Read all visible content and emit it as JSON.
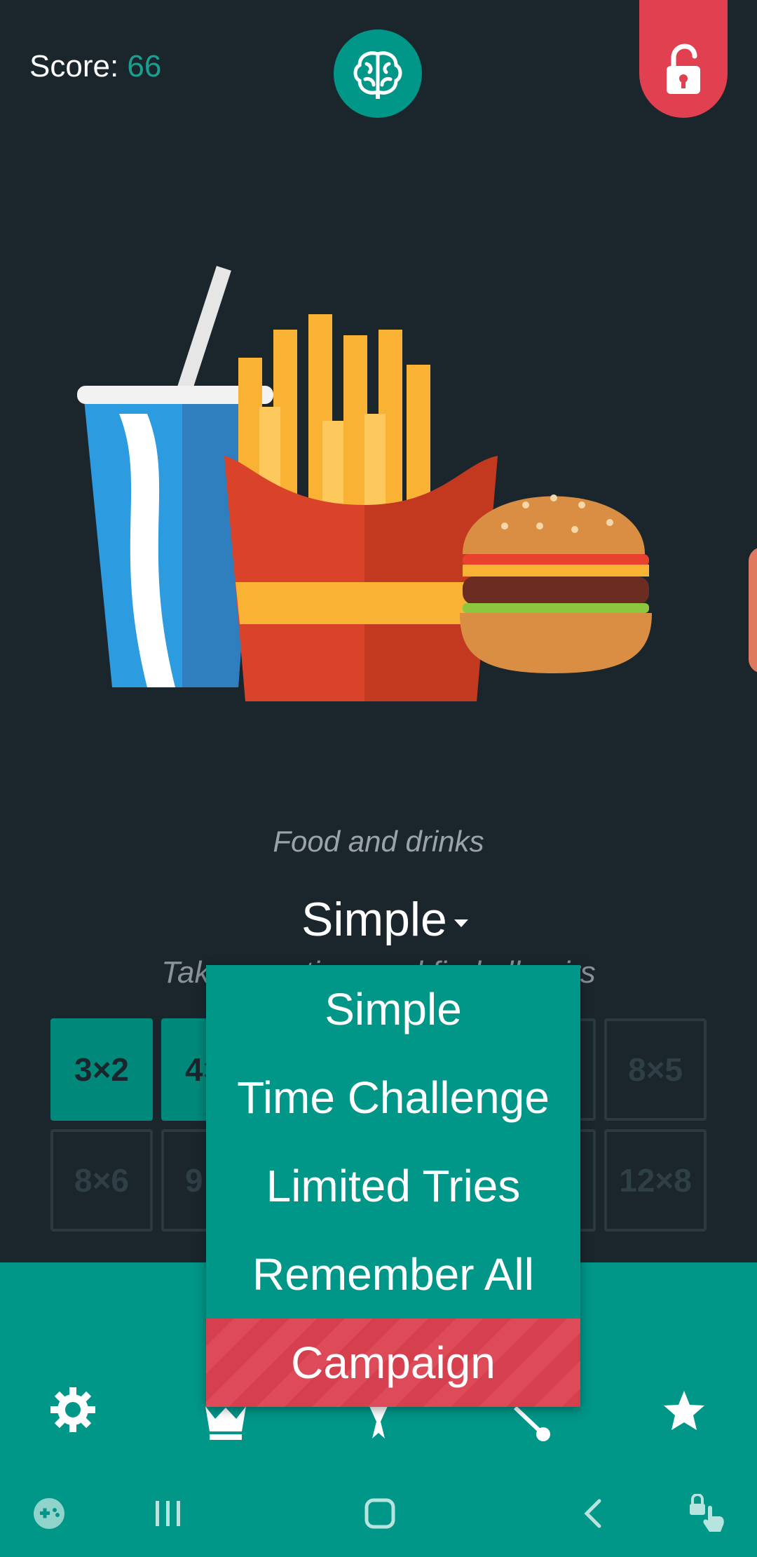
{
  "header": {
    "score_label": "Score:",
    "score_value": "66",
    "brain_icon": "brain-icon",
    "lock_icon": "unlock-icon"
  },
  "theme": {
    "primary": "#009688",
    "accent": "#e0404f",
    "background": "#1b262c"
  },
  "category": "Food and drinks",
  "mode": {
    "selected": "Simple"
  },
  "description": "Take your time and find all pairs",
  "grid": {
    "row1": [
      "3×2",
      "4×",
      "",
      "",
      "",
      "8×5"
    ],
    "row2": [
      "8×6",
      "9",
      "",
      "",
      "",
      "12×8"
    ]
  },
  "dropdown": {
    "options": [
      "Simple",
      "Time Challenge",
      "Limited Tries",
      "Remember All",
      "Campaign"
    ],
    "highlighted": "Campaign"
  },
  "bottom_nav": [
    "gear-icon",
    "crown-icon",
    "award-icon",
    "share-icon",
    "star-icon"
  ],
  "system_nav": [
    "game-launcher-icon",
    "recents-icon",
    "home-icon",
    "back-icon",
    "touch-lock-icon"
  ]
}
